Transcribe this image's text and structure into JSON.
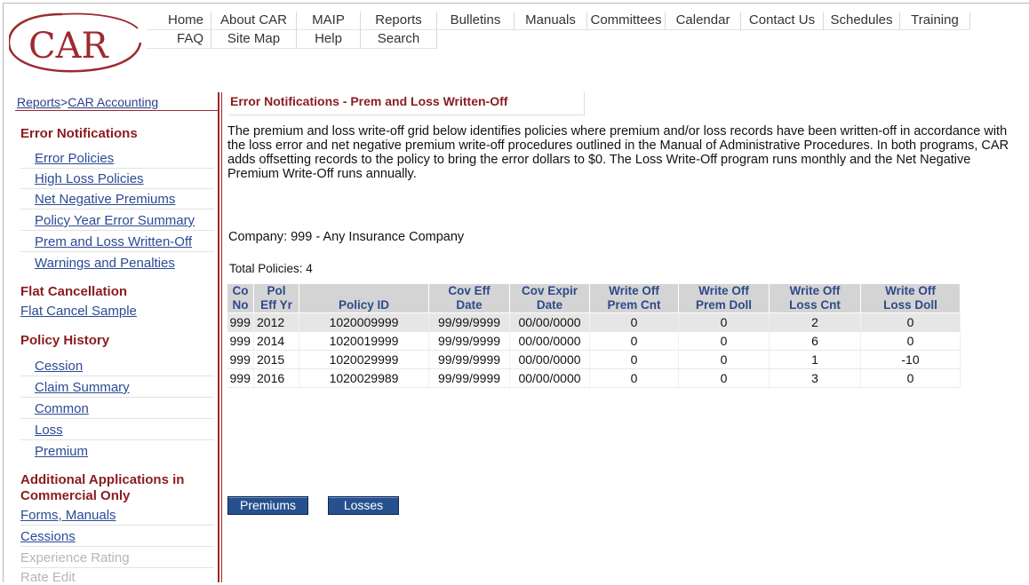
{
  "brand": {
    "logo_text": "CAR",
    "logo_color": "#9c2a2f"
  },
  "nav": {
    "row1": [
      "Home",
      "About CAR",
      "MAIP",
      "Reports",
      "Bulletins",
      "Manuals",
      "Committees",
      "Calendar",
      "Contact Us",
      "Schedules",
      "Training"
    ],
    "row2": [
      "FAQ",
      "Site Map",
      "Help",
      "Search"
    ]
  },
  "breadcrumb": {
    "root": "Reports",
    "sep": " > ",
    "current": "CAR Accounting"
  },
  "sidebar": {
    "error_head": "Error Notifications",
    "error_items": [
      "Error Policies",
      "High Loss Policies",
      "Net Negative Premiums",
      "Policy Year Error Summary",
      "Prem and Loss Written-Off",
      "Warnings and Penalties"
    ],
    "flat_head": "Flat Cancellation",
    "flat_items": [
      "Flat Cancel Sample"
    ],
    "history_head": "Policy History",
    "history_items": [
      "Cession",
      "Claim Summary",
      "Common",
      "Loss",
      "Premium"
    ],
    "additional_head_1": "Additional Applications in",
    "additional_head_2": "Commercial Only",
    "additional_links": [
      "Forms, Manuals",
      "Cessions"
    ],
    "additional_disabled": [
      "Experience Rating",
      "Rate Edit"
    ]
  },
  "main": {
    "title": "Error Notifications - Prem and Loss Written-Off",
    "intro": "The premium and loss write-off grid below identifies policies where premium and/or loss records have been written-off in accordance with the loss error and net negative premium write-off procedures outlined in the Manual of Administrative Procedures. In both programs, CAR adds offsetting records to the policy to bring the error dollars to $0.  The Loss Write-Off program runs monthly and the Net Negative Premium Write-Off runs annually.",
    "company_label": "Company",
    "company_value": ": 999 - Any Insurance Company",
    "total_label": "Total Policies: 4"
  },
  "grid": {
    "headers": [
      [
        "Co",
        "No"
      ],
      [
        "Pol",
        "Eff Yr"
      ],
      [
        "",
        "Policy ID"
      ],
      [
        "Cov Eff",
        "Date"
      ],
      [
        "Cov Expir",
        "Date"
      ],
      [
        "Write Off",
        "Prem Cnt"
      ],
      [
        "Write Off",
        "Prem Doll"
      ],
      [
        "Write Off",
        "Loss Cnt"
      ],
      [
        "Write Off",
        "Loss Doll"
      ]
    ],
    "rows": [
      [
        "999",
        "2012",
        "1020009999",
        "99/99/9999",
        "00/00/0000",
        "0",
        "0",
        "2",
        "0"
      ],
      [
        "999",
        "2014",
        "1020019999",
        "99/99/9999",
        "00/00/0000",
        "0",
        "0",
        "6",
        "0"
      ],
      [
        "999",
        "2015",
        "1020029999",
        "99/99/9999",
        "00/00/0000",
        "0",
        "0",
        "1",
        "-10"
      ],
      [
        "999",
        "2016",
        "1020029989",
        "99/99/9999",
        "00/00/0000",
        "0",
        "0",
        "3",
        "0"
      ]
    ]
  },
  "buttons": {
    "premiums": "Premiums",
    "losses": "Losses"
  }
}
